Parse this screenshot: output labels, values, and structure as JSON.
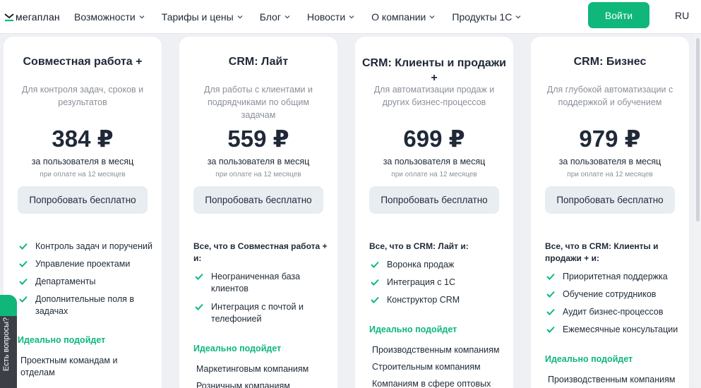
{
  "header": {
    "logo_text": "мегаплан",
    "nav": [
      {
        "label": "Возможности"
      },
      {
        "label": "Тарифы и цены"
      },
      {
        "label": "Блог"
      },
      {
        "label": "Новости"
      },
      {
        "label": "О компании"
      },
      {
        "label": "Продукты 1С"
      }
    ],
    "login_label": "Войти",
    "lang": "RU"
  },
  "help_tab": {
    "label": "Есть вопросы?"
  },
  "colors": {
    "accent": "#0fb77b",
    "button_bg": "#e8edf2"
  },
  "plans": [
    {
      "title": "Совместная работа +",
      "desc": "Для контроля задач, сроков и результатов",
      "price": "384 ₽",
      "per_user": "за пользователя в месяц",
      "pay_note": "при оплате на 12 месяцев",
      "button": "Попробовать бесплатно",
      "intro": "",
      "features": [
        "Контроль задач и поручений",
        "Управление проектами",
        "Департаменты",
        "Дополнительные поля в задачах"
      ],
      "ideal_title": "Идеально подойдет",
      "ideal_for": [
        "Проектным командам и отделам"
      ]
    },
    {
      "title": "CRM: Лайт",
      "desc": "Для работы с клиентами и подрядчиками по общим задачам",
      "price": "559 ₽",
      "per_user": "за пользователя в месяц",
      "pay_note": "при оплате на 12 месяцев",
      "button": "Попробовать бесплатно",
      "intro": "Все, что в Совместная работа + и:",
      "features": [
        "Неограниченная база клиентов",
        "Интеграция с почтой и телефонией"
      ],
      "ideal_title": "Идеально подойдет",
      "ideal_for": [
        "Маркетинговым компаниям",
        "Розничным компаниям"
      ]
    },
    {
      "title": "CRM: Клиенты и продажи +",
      "desc": "Для автоматизации продаж и других бизнес-процессов",
      "price": "699 ₽",
      "per_user": "за пользователя в месяц",
      "pay_note": "при оплате на 12 месяцев",
      "button": "Попробовать бесплатно",
      "intro": "Все, что в CRM: Лайт и:",
      "features": [
        "Воронка продаж",
        "Интеграция с 1С",
        "Конструктор CRM"
      ],
      "ideal_title": "Идеально подойдет",
      "ideal_for": [
        "Производственным компаниям",
        "Строительным компаниям",
        "Компаниям в сфере оптовых"
      ]
    },
    {
      "title": "CRM: Бизнес",
      "desc": "Для глубокой автоматизации с поддержкой и обучением",
      "price": "979 ₽",
      "per_user": "за пользователя в месяц",
      "pay_note": "при оплате на 12 месяцев",
      "button": "Попробовать бесплатно",
      "intro": "Все, что в CRM: Клиенты и продажи + и:",
      "features": [
        "Приоритетная поддержка",
        "Обучение сотрудников",
        "Аудит бизнес-процессов",
        "Ежемесячные консультации"
      ],
      "ideal_title": "Идеально подойдет",
      "ideal_for": [
        "Производственным компаниям"
      ]
    }
  ]
}
